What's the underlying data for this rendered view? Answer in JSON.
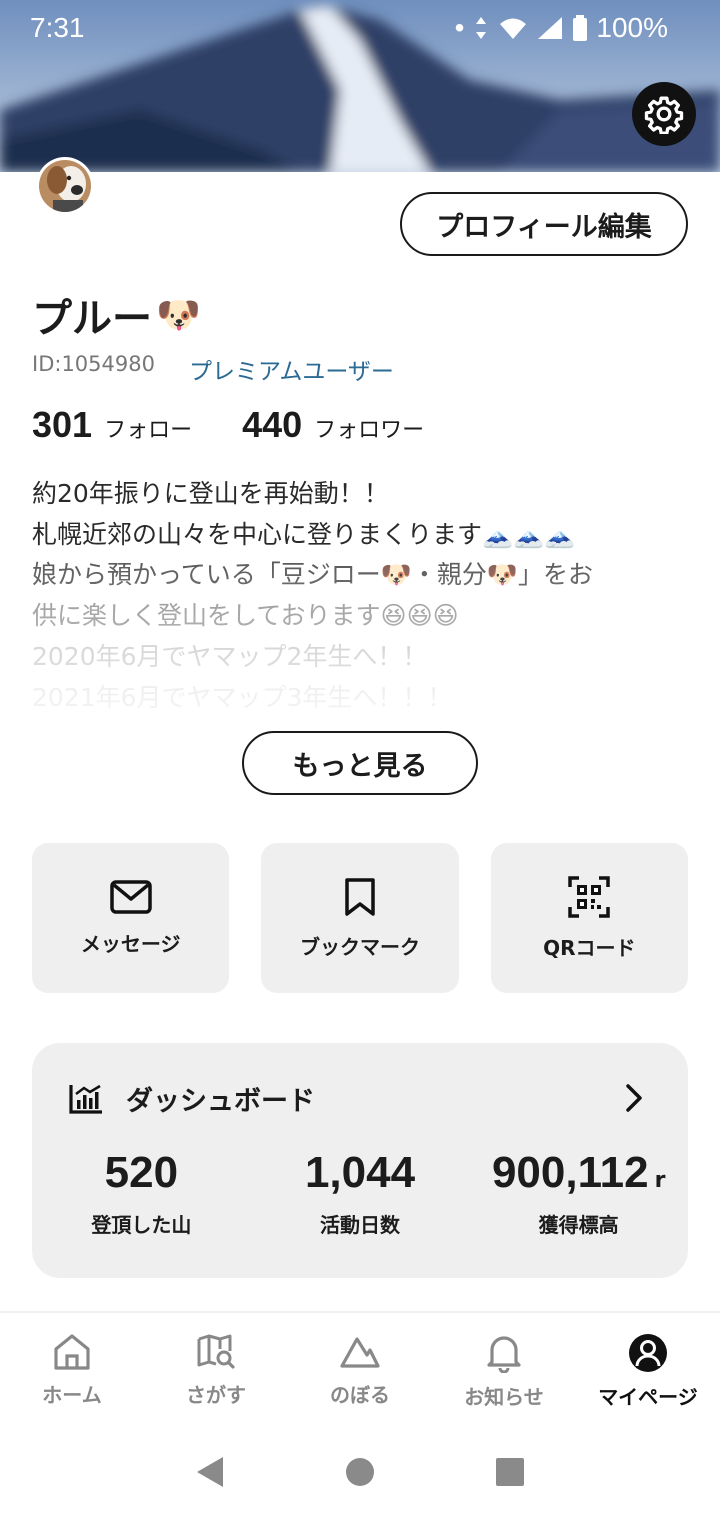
{
  "status_bar": {
    "time": "7:31",
    "battery": "100%"
  },
  "profile": {
    "edit_button": "プロフィール編集",
    "name": "プルー",
    "name_emoji": "🐶",
    "id": "ID:1054980",
    "badge": "プレミアムユーザー",
    "follow_count": "301",
    "follow_label": "フォロー",
    "follower_count": "440",
    "follower_label": "フォロワー"
  },
  "bio": {
    "lines": [
      "約20年振りに登山を再始動！！",
      "札幌近郊の山々を中心に登りまくります🗻🗻🗻",
      "娘から預かっている「豆ジロー🐶・親分🐶」をお",
      "供に楽しく登山をしております😆😆😆",
      "2020年6月でヤマップ2年生へ！！",
      "2021年6月でヤマップ3年生へ！！！"
    ],
    "more_button": "もっと見る"
  },
  "tiles": [
    {
      "label": "メッセージ",
      "icon": "mail-icon"
    },
    {
      "label": "ブックマーク",
      "icon": "bookmark-icon"
    },
    {
      "label": "QRコード",
      "icon": "qr-code-icon"
    }
  ],
  "dashboard": {
    "title": "ダッシュボード",
    "stats": [
      {
        "value": "520",
        "unit": "",
        "label": "登頂した山"
      },
      {
        "value": "1,044",
        "unit": "",
        "label": "活動日数"
      },
      {
        "value": "900,112",
        "unit": "r",
        "label": "獲得標高"
      }
    ]
  },
  "tabbar": [
    {
      "label": "ホーム",
      "icon": "home-icon",
      "active": false
    },
    {
      "label": "さがす",
      "icon": "map-search-icon",
      "active": false
    },
    {
      "label": "のぼる",
      "icon": "mountain-icon",
      "active": false
    },
    {
      "label": "お知らせ",
      "icon": "bell-icon",
      "active": false
    },
    {
      "label": "マイページ",
      "icon": "user-icon",
      "active": true
    }
  ],
  "colors": {
    "premium": "#2a6a93",
    "tile_bg": "#efefef"
  }
}
